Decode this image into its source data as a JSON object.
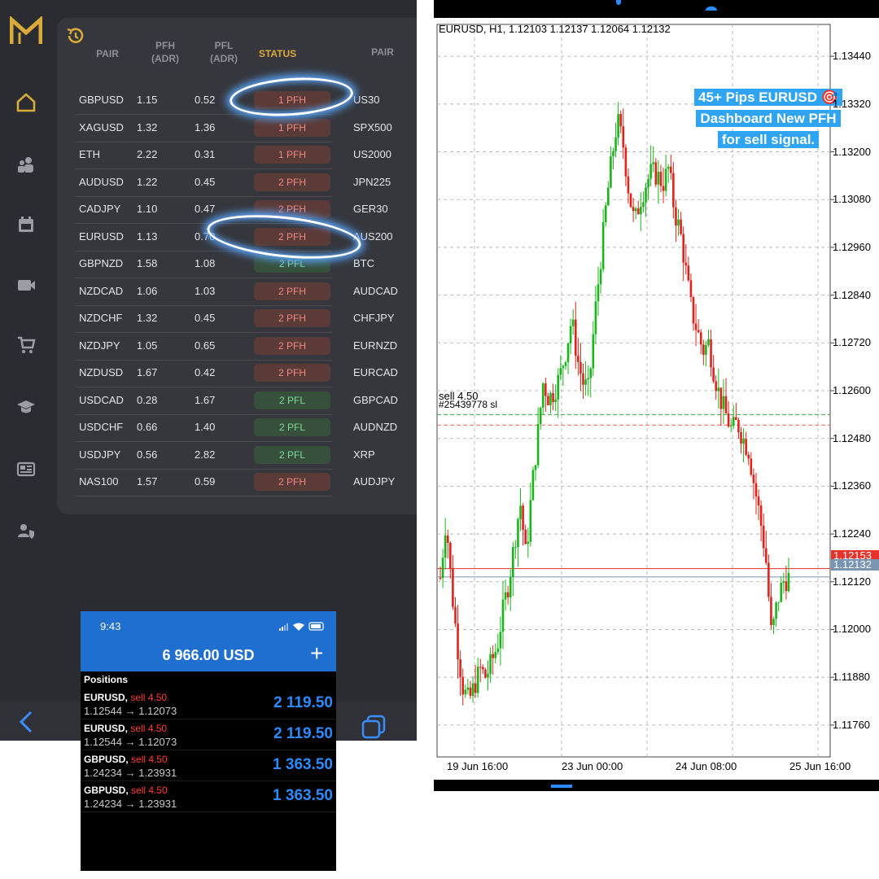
{
  "dashboard": {
    "headers": {
      "pair": "PAIR",
      "pfh": "PFH",
      "pfh_sub": "(ADR)",
      "pfl": "PFL",
      "pfl_sub": "(ADR)",
      "status": "STATUS",
      "pair2": "PAIR"
    },
    "rows": [
      {
        "pair": "GBPUSD",
        "pfh": "1.15",
        "pfl": "0.52",
        "status": "1 PFH",
        "kind": "pfh",
        "pair2": "US30"
      },
      {
        "pair": "XAGUSD",
        "pfh": "1.32",
        "pfl": "1.36",
        "status": "1 PFH",
        "kind": "pfh",
        "pair2": "SPX500"
      },
      {
        "pair": "ETH",
        "pfh": "2.22",
        "pfl": "0.31",
        "status": "1 PFH",
        "kind": "pfh",
        "pair2": "US2000"
      },
      {
        "pair": "AUDUSD",
        "pfh": "1.22",
        "pfl": "0.45",
        "status": "2 PFH",
        "kind": "pfh",
        "pair2": "JPN225"
      },
      {
        "pair": "CADJPY",
        "pfh": "1.10",
        "pfl": "0.47",
        "status": "2 PFH",
        "kind": "pfh",
        "pair2": "GER30"
      },
      {
        "pair": "EURUSD",
        "pfh": "1.13",
        "pfl": "0.70",
        "status": "2 PFH",
        "kind": "pfh",
        "pair2": "AUS200"
      },
      {
        "pair": "GBPNZD",
        "pfh": "1.58",
        "pfl": "1.08",
        "status": "2 PFL",
        "kind": "pfl",
        "pair2": "BTC"
      },
      {
        "pair": "NZDCAD",
        "pfh": "1.06",
        "pfl": "1.03",
        "status": "2 PFH",
        "kind": "pfh",
        "pair2": "AUDCAD"
      },
      {
        "pair": "NZDCHF",
        "pfh": "1.32",
        "pfl": "0.45",
        "status": "2 PFH",
        "kind": "pfh",
        "pair2": "CHFJPY"
      },
      {
        "pair": "NZDJPY",
        "pfh": "1.05",
        "pfl": "0.65",
        "status": "2 PFH",
        "kind": "pfh",
        "pair2": "EURNZD"
      },
      {
        "pair": "NZDUSD",
        "pfh": "1.67",
        "pfl": "0.42",
        "status": "2 PFH",
        "kind": "pfh",
        "pair2": "EURCAD"
      },
      {
        "pair": "USDCAD",
        "pfh": "0.28",
        "pfl": "1.67",
        "status": "2 PFL",
        "kind": "pfl",
        "pair2": "GBPCAD"
      },
      {
        "pair": "USDCHF",
        "pfh": "0.66",
        "pfl": "1.40",
        "status": "2 PFL",
        "kind": "pfl",
        "pair2": "AUDNZD"
      },
      {
        "pair": "USDJPY",
        "pfh": "0.56",
        "pfl": "2.82",
        "status": "2 PFL",
        "kind": "pfl",
        "pair2": "XRP"
      },
      {
        "pair": "NAS100",
        "pfh": "1.57",
        "pfl": "0.59",
        "status": "2 PFH",
        "kind": "pfh",
        "pair2": "AUDJPY"
      }
    ],
    "nav_icons": [
      "logo-m-icon",
      "home-icon",
      "users-icon",
      "calendar-icon",
      "video-icon",
      "cart-icon",
      "graduation-cap-icon",
      "news-icon",
      "user-shield-icon"
    ],
    "colors": {
      "accent": "#d9a93a",
      "pfh": "#f08a80",
      "pfl": "#7fdd9a"
    }
  },
  "phone": {
    "time": "9:43",
    "balance": "6 966.00 USD",
    "add_label": "+",
    "positions_title": "Positions",
    "positions": [
      {
        "symbol": "EURUSD,",
        "side": "sell 4.50",
        "prices": "1.12544 → 1.12073",
        "pl": "2 119.50"
      },
      {
        "symbol": "EURUSD,",
        "side": "sell 4.50",
        "prices": "1.12544 → 1.12073",
        "pl": "2 119.50"
      },
      {
        "symbol": "GBPUSD,",
        "side": "sell 4.50",
        "prices": "1.24234 → 1.23931",
        "pl": "1 363.50"
      },
      {
        "symbol": "GBPUSD,",
        "side": "sell 4.50",
        "prices": "1.24234 → 1.23931",
        "pl": "1 363.50"
      }
    ]
  },
  "chart": {
    "info": "EURUSD, H1, 1.12103 1.12137 1.12064 1.12132",
    "callout": [
      "45+ Pips EURUSD 🎯",
      "Dashboard New PFH",
      "for sell signal."
    ],
    "order_label_1": "sell 4.50",
    "order_label_2": "#25439778 sl",
    "price_labels": [
      "1.13440",
      "1.13320",
      "1.13200",
      "1.13080",
      "1.12960",
      "1.12840",
      "1.12720",
      "1.12600",
      "1.12480",
      "1.12360",
      "1.12240",
      "1.12120",
      "1.12000",
      "1.11880",
      "1.11760"
    ],
    "ask_label": "1.12153",
    "bid_label": "1.12132",
    "time_labels": [
      "19 Jun 16:00",
      "23 Jun 00:00",
      "24 Jun 08:00",
      "25 Jun 16:00"
    ]
  },
  "chart_data": {
    "type": "candlestick",
    "symbol": "EURUSD",
    "timeframe": "H1",
    "ylim": [
      1.1168,
      1.1352
    ],
    "y_ticks": [
      1.1344,
      1.1332,
      1.132,
      1.1308,
      1.1296,
      1.1284,
      1.1272,
      1.126,
      1.1248,
      1.1236,
      1.1224,
      1.1212,
      1.12,
      1.1188,
      1.1176
    ],
    "x_ticks": [
      "19 Jun 16:00",
      "23 Jun 00:00",
      "24 Jun 08:00",
      "25 Jun 16:00"
    ],
    "order_line": 1.1254,
    "sl_line": 1.1253,
    "ask": 1.12153,
    "bid": 1.12132,
    "close_path": [
      1.1213,
      1.1228,
      1.121,
      1.1196,
      1.1185,
      1.1182,
      1.1186,
      1.119,
      1.1188,
      1.1192,
      1.1196,
      1.1205,
      1.1212,
      1.1222,
      1.1232,
      1.1218,
      1.1235,
      1.1248,
      1.1262,
      1.1258,
      1.126,
      1.1264,
      1.127,
      1.1278,
      1.1268,
      1.1262,
      1.126,
      1.1278,
      1.1292,
      1.1306,
      1.1318,
      1.1328,
      1.1322,
      1.131,
      1.1302,
      1.1308,
      1.1312,
      1.1315,
      1.1314,
      1.1312,
      1.1316,
      1.1305,
      1.13,
      1.129,
      1.128,
      1.1275,
      1.127,
      1.1272,
      1.1264,
      1.1258,
      1.1254,
      1.125,
      1.1252,
      1.1248,
      1.1245,
      1.1236,
      1.1228,
      1.1218,
      1.1198,
      1.1207,
      1.1212,
      1.1213
    ]
  }
}
